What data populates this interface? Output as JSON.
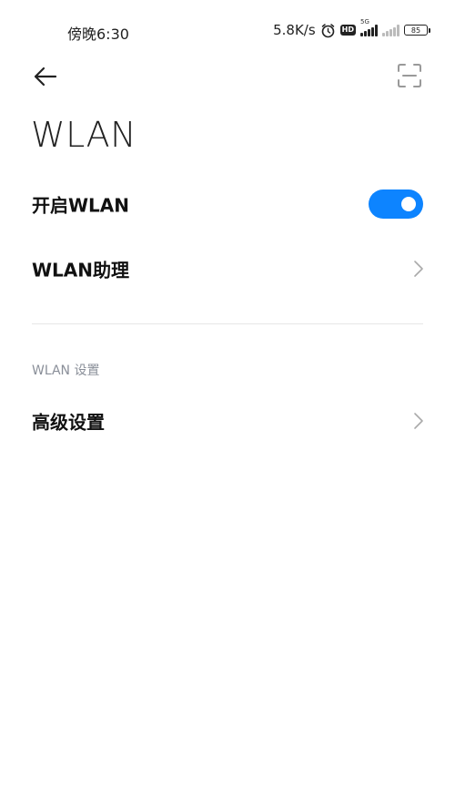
{
  "status_bar": {
    "time": "傍晚6:30",
    "net_speed": "5.8K/s",
    "hd_label": "HD",
    "network_type": "5G",
    "battery": "85",
    "icons": [
      "alarm-icon",
      "hd-icon",
      "signal-icon",
      "signal-secondary-icon",
      "battery-icon"
    ]
  },
  "header": {
    "back_icon": "back-arrow-icon",
    "scan_icon": "scan-icon",
    "title": "WLAN"
  },
  "main": {
    "toggle_row": {
      "label": "开启WLAN",
      "enabled": true,
      "accent": "#0d84ff"
    },
    "assistant_row": {
      "label": "WLAN助理"
    },
    "section_header": "WLAN 设置",
    "advanced_row": {
      "label": "高级设置"
    }
  }
}
